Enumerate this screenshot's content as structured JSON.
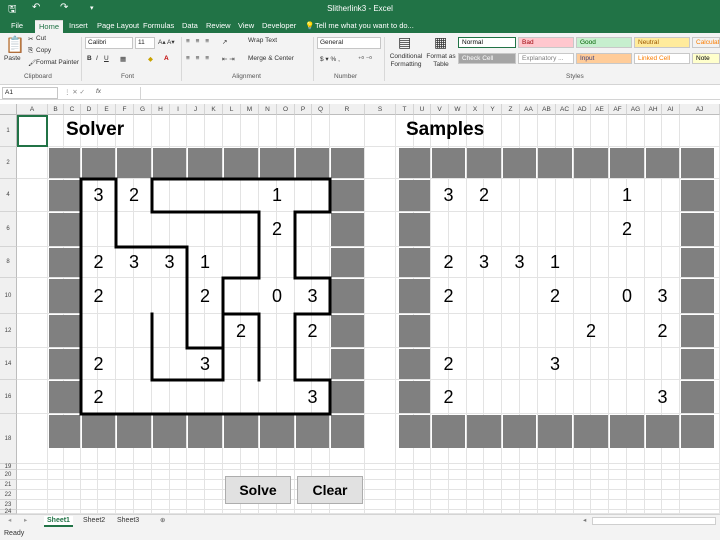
{
  "window": {
    "title": "Slitherlink3 - Excel",
    "qa_icons": [
      "save-icon",
      "undo-icon",
      "redo-icon",
      "customize-icon"
    ]
  },
  "tabs": [
    "File",
    "Home",
    "Insert",
    "Page Layout",
    "Formulas",
    "Data",
    "Review",
    "View",
    "Developer"
  ],
  "active_tab": "Home",
  "tell_me": "Tell me what you want to do...",
  "ribbon": {
    "paste": "Paste",
    "cut": "Cut",
    "copy": "Copy",
    "format_painter": "Format Painter",
    "font_name": "Calibri",
    "font_size": "11",
    "wrap_text": "Wrap Text",
    "merge_center": "Merge & Center",
    "number_format": "General",
    "conditional_formatting": "Conditional Formatting",
    "format_as_table": "Format as Table",
    "groups": {
      "clipboard": "Clipboard",
      "font": "Font",
      "alignment": "Alignment",
      "number": "Number",
      "styles": "Styles"
    },
    "styles": [
      {
        "label": "Normal",
        "bg": "#ffffff",
        "fg": "#000000"
      },
      {
        "label": "Bad",
        "bg": "#ffc7ce",
        "fg": "#9c0006"
      },
      {
        "label": "Good",
        "bg": "#c6efce",
        "fg": "#006100"
      },
      {
        "label": "Neutral",
        "bg": "#ffeb9c",
        "fg": "#9c5700"
      },
      {
        "label": "Calculation",
        "bg": "#f2f2f2",
        "fg": "#fa7d00"
      },
      {
        "label": "Check Cell",
        "bg": "#a5a5a5",
        "fg": "#ffffff"
      },
      {
        "label": "Explanatory ...",
        "bg": "#ffffff",
        "fg": "#7f7f7f"
      },
      {
        "label": "Input",
        "bg": "#ffcc99",
        "fg": "#3f3f76"
      },
      {
        "label": "Linked Cell",
        "bg": "#ffffff",
        "fg": "#fa7d00"
      },
      {
        "label": "Note",
        "bg": "#ffffcc",
        "fg": "#000000"
      }
    ]
  },
  "name_box": "A1",
  "fx": "fx",
  "columns": [
    "A",
    "B",
    "C",
    "D",
    "E",
    "F",
    "G",
    "H",
    "I",
    "J",
    "K",
    "L",
    "M",
    "N",
    "O",
    "P",
    "Q",
    "R",
    "S",
    "T",
    "U",
    "V",
    "W",
    "X",
    "Y",
    "Z",
    "AA",
    "AB",
    "AC",
    "AD",
    "AE",
    "AF",
    "AG",
    "AH",
    "AI"
  ],
  "rows": [
    "1",
    "2",
    "4",
    "6",
    "8",
    "10",
    "12",
    "14",
    "16",
    "18",
    "19",
    "20",
    "21",
    "22",
    "23",
    "24"
  ],
  "solver_title": "Solver",
  "samples_title": "Samples",
  "dark_cell_color": "#808080",
  "puzzle": [
    [
      "3",
      "2",
      "",
      "",
      "",
      "1",
      ""
    ],
    [
      "",
      "",
      "",
      "",
      "",
      "2",
      ""
    ],
    [
      "2",
      "3",
      "3",
      "1",
      "",
      "",
      ""
    ],
    [
      "2",
      "",
      "",
      "2",
      "",
      "0",
      "3"
    ],
    [
      "",
      "",
      "",
      "",
      "2",
      "",
      "2"
    ],
    [
      "2",
      "",
      "",
      "3",
      "",
      "",
      ""
    ],
    [
      "2",
      "",
      "",
      "",
      "",
      "",
      "3"
    ]
  ],
  "buttons": {
    "solve": "Solve",
    "clear": "Clear"
  },
  "sheets": [
    "Sheet1",
    "Sheet2",
    "Sheet3"
  ],
  "active_sheet": "Sheet1",
  "status": "Ready"
}
